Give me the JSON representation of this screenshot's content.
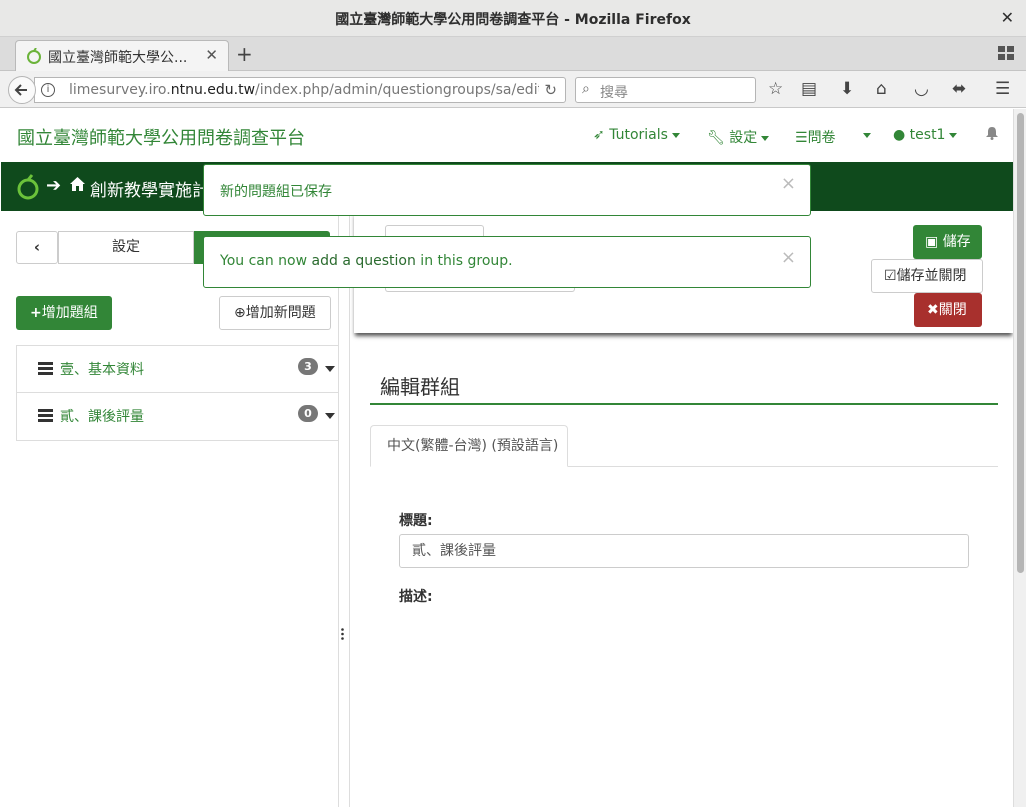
{
  "window": {
    "title": "國立臺灣師範大學公用問卷調查平台 - Mozilla Firefox"
  },
  "browser": {
    "tab_label": "國立臺灣師範大學公...",
    "url_prefix": "limesurvey.iro.",
    "url_domain": "ntnu.edu.tw",
    "url_suffix": "/index.php/admin/questiongroups/sa/edit/s",
    "search_placeholder": "搜尋"
  },
  "topnav": {
    "brand": "國立臺灣師範大學公用問卷調查平台",
    "tutorials": "Tutorials",
    "settings": "設定",
    "surveys": "問卷",
    "user": "test1"
  },
  "breadcrumb": {
    "text": "創新教學實施計"
  },
  "sidebar": {
    "settings_tab": "設定",
    "add_group": "增加題組",
    "add_question": "增加新問題",
    "groups": [
      {
        "name": "壹、基本資料",
        "count": "3"
      },
      {
        "name": "貳、課後評量",
        "count": "0"
      }
    ]
  },
  "actions": {
    "save": "儲存",
    "save_close": "儲存並關閉",
    "close": "關閉"
  },
  "editor": {
    "section_title": "編輯群組",
    "language_tab": "中文(繁體-台灣) (預設語言)",
    "title_label": "標題:",
    "title_value": "貳、課後評量",
    "description_label": "描述:"
  },
  "notifications": {
    "saved": "新的問題組已保存",
    "hint_prefix": "You can now ",
    "hint_link": "add a question",
    "hint_suffix": " in this group."
  },
  "colors": {
    "brand_green": "#328637",
    "header_dark_green": "#0f4a1c",
    "danger_red": "#a8302d"
  }
}
